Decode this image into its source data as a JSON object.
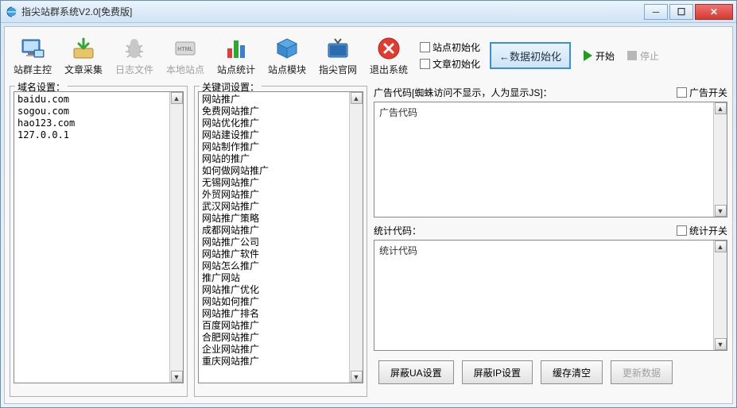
{
  "window": {
    "title": "指尖站群系统V2.0[免费版]"
  },
  "toolbar": {
    "items": [
      {
        "label": "站群主控"
      },
      {
        "label": "文章采集"
      },
      {
        "label": "日志文件",
        "disabled": true
      },
      {
        "label": "本地站点",
        "disabled": true
      },
      {
        "label": "站点统计"
      },
      {
        "label": "站点模块"
      },
      {
        "label": "指尖官网"
      },
      {
        "label": "退出系统"
      }
    ],
    "checkboxes": {
      "site_init": "站点初始化",
      "article_init": "文章初始化"
    },
    "data_init_btn": "←数据初始化",
    "start": "开始",
    "stop": "停止"
  },
  "domain_panel": {
    "legend": "域名设置：",
    "items": [
      "baidu.com",
      "sogou.com",
      "hao123.com",
      "127.0.0.1"
    ]
  },
  "keyword_panel": {
    "legend": "关键词设置：",
    "items": [
      "网站推广",
      "免费网站推广",
      "网站优化推广",
      "网站建设推广",
      "网站制作推广",
      "网站的推广",
      "如何做网站推广",
      "无锡网站推广",
      "外贸网站推广",
      "武汉网站推广",
      "网站推广策略",
      "成都网站推广",
      "网站推广公司",
      "网站推广软件",
      "网站怎么推广",
      "推广网站",
      "网站推广优化",
      "网站如何推广",
      "网站推广排名",
      "百度网站推广",
      "合肥网站推广",
      "企业网站推广",
      "重庆网站推广"
    ]
  },
  "ad_panel": {
    "label": "广告代码[蜘蛛访问不显示，人为显示JS]：",
    "switch_label": "广告开关",
    "placeholder": "广告代码"
  },
  "stat_panel": {
    "label": "统计代码：",
    "switch_label": "统计开关",
    "placeholder": "统计代码"
  },
  "bottom_buttons": {
    "ua": "屏蔽UA设置",
    "ip": "屏蔽IP设置",
    "cache": "缓存清空",
    "update": "更新数据"
  }
}
